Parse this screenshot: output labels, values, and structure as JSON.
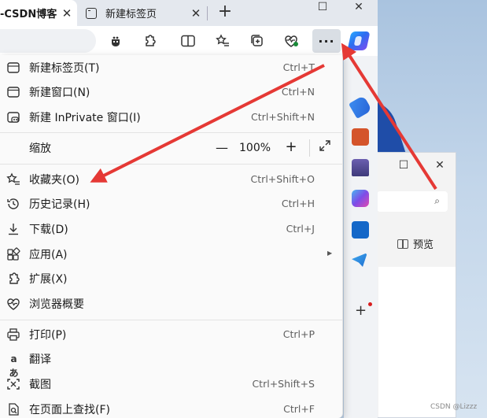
{
  "browser": {
    "tabs": [
      {
        "label": "-CSDN博客",
        "active": true
      },
      {
        "label": "新建标签页",
        "active": false
      }
    ],
    "new_tab_symbol": "+",
    "window_controls": {
      "minimize": "—",
      "maximize": "☐",
      "close": "✕"
    },
    "toolbar_icons": [
      "bug-icon",
      "extensions-icon",
      "split-screen-icon",
      "favorites-icon",
      "collections-icon",
      "browser-essentials-icon"
    ],
    "more_button_label": "···"
  },
  "menu": {
    "items_group1": [
      {
        "label": "新建标签页(T)",
        "shortcut": "Ctrl+T",
        "icon": "new-tab-icon"
      },
      {
        "label": "新建窗口(N)",
        "shortcut": "Ctrl+N",
        "icon": "new-window-icon"
      },
      {
        "label": "新建 InPrivate 窗口(I)",
        "shortcut": "Ctrl+Shift+N",
        "icon": "inprivate-icon"
      }
    ],
    "zoom": {
      "label": "缩放",
      "value": "100%",
      "minus": "—",
      "plus": "+"
    },
    "items_group2": [
      {
        "label": "收藏夹(O)",
        "shortcut": "Ctrl+Shift+O",
        "icon": "favorites-icon"
      },
      {
        "label": "历史记录(H)",
        "shortcut": "Ctrl+H",
        "icon": "history-icon"
      },
      {
        "label": "下载(D)",
        "shortcut": "Ctrl+J",
        "icon": "download-icon"
      },
      {
        "label": "应用(A)",
        "shortcut": "",
        "icon": "apps-icon"
      },
      {
        "label": "扩展(X)",
        "shortcut": "",
        "icon": "extensions-icon"
      },
      {
        "label": "浏览器概要",
        "shortcut": "",
        "icon": "browser-essentials-icon"
      }
    ],
    "items_group3": [
      {
        "label": "打印(P)",
        "shortcut": "Ctrl+P",
        "icon": "print-icon"
      },
      {
        "label": "翻译",
        "shortcut": "",
        "icon": "translate-icon"
      },
      {
        "label": "截图",
        "shortcut": "Ctrl+Shift+S",
        "icon": "screenshot-icon"
      },
      {
        "label": "在页面上查找(F)",
        "shortcut": "Ctrl+F",
        "icon": "find-icon"
      }
    ]
  },
  "second_window": {
    "preview_label": "预览"
  },
  "watermark": "CSDN @Lizzz",
  "colors": {
    "arrow": "#e53935",
    "menu_bg": "#fafafa",
    "tabbar_bg": "#e4e8ee",
    "accent": "#2d6cf0"
  }
}
